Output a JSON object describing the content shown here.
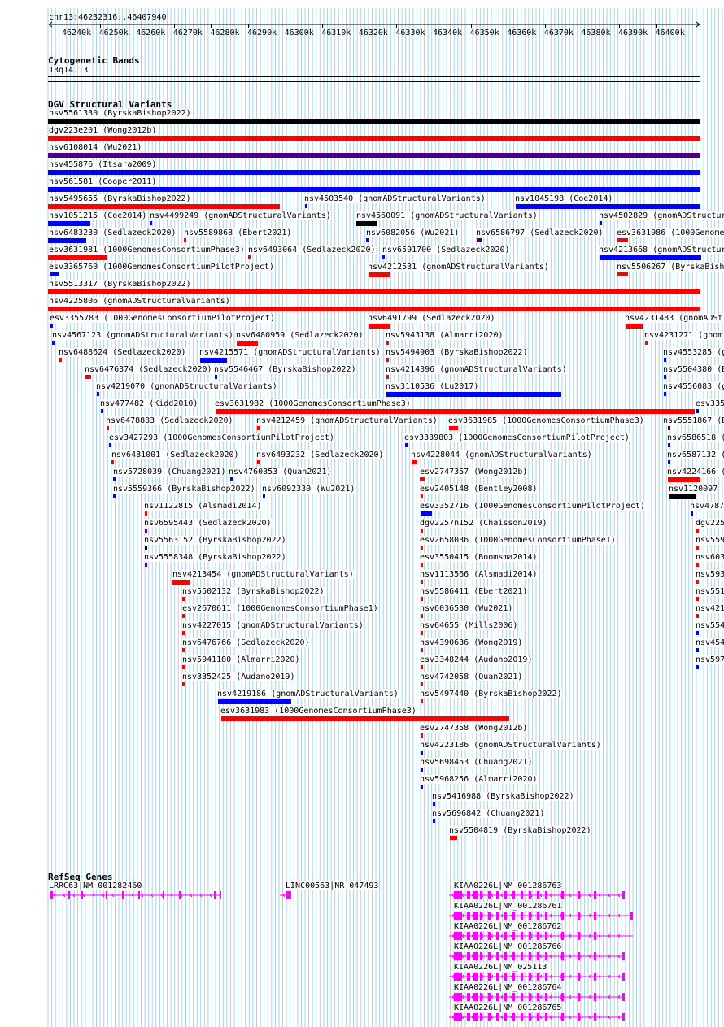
{
  "coords": "chr13:46232316..46407940",
  "ruler_ticks": [
    "46240k",
    "46250k",
    "46260k",
    "46270k",
    "46280k",
    "46290k",
    "46300k",
    "46310k",
    "46320k",
    "46330k",
    "46340k",
    "46350k",
    "46360k",
    "46370k",
    "46380k",
    "46390k",
    "46400k"
  ],
  "cyto": {
    "title": "Cytogenetic Bands",
    "band": "13q14.13"
  },
  "dgv_title": "DGV Structural Variants",
  "refseq_title": "RefSeq Genes",
  "colors": {
    "red": "#ff0000",
    "blue": "#0000ff",
    "black": "#000000",
    "purple": "#4b0082",
    "magenta": "#ff00ff",
    "grid": "#a8d4e4"
  },
  "variants": [
    {
      "label": "nsv5561330 (ByrskaBishop2022)",
      "color": "black"
    },
    {
      "label": "dgv223e201 (Wong2012b)",
      "color": "red"
    },
    {
      "label": "nsv6108014 (Wu2021)",
      "color": "purple"
    },
    {
      "label": "nsv455876 (Itsara2009)",
      "color": "blue"
    },
    {
      "label": "nsv561581 (Cooper2011)",
      "color": "blue"
    },
    {
      "label": "nsv5495655 (ByrskaBishop2022)",
      "color": "red"
    },
    {
      "label": "nsv4503540 (gnomADStructuralVariants)",
      "color": "blue"
    },
    {
      "label": "nsv1045198 (Coe2014)",
      "color": "blue"
    },
    {
      "label": "nsv1051215 (Coe2014)",
      "color": "blue"
    },
    {
      "label": "nsv4499249 (gnomADStructuralVariants)",
      "color": "blue"
    },
    {
      "label": "nsv4560091 (gnomADStructuralVariants)",
      "color": "black"
    },
    {
      "label": "nsv4502829 (gnomADStructur",
      "color": "blue"
    },
    {
      "label": "nsv6483230 (Sedlazeck2020)",
      "color": "blue"
    },
    {
      "label": "nsv5589868 (Ebert2021)",
      "color": "red"
    },
    {
      "label": "nsv6082056 (Wu2021)",
      "color": "blue"
    },
    {
      "label": "nsv6586797 (Sedlazeck2020)",
      "color": "purple"
    },
    {
      "label": "esv3631986 (1000Genome",
      "color": "red"
    },
    {
      "label": "esv3631981 (1000GenomesConsortiumPhase3)",
      "color": "red"
    },
    {
      "label": "nsv6493064 (Sedlazeck2020)",
      "color": "red"
    },
    {
      "label": "nsv6591700 (Sedlazeck2020)",
      "color": "blue"
    },
    {
      "label": "nsv4213668 (gnomADStructur",
      "color": "blue"
    },
    {
      "label": "esv3365760 (1000GenomesConsortiumPilotProject)",
      "color": "blue"
    },
    {
      "label": "nsv4212531 (gnomADStructuralVariants)",
      "color": "red"
    },
    {
      "label": "nsv5506267 (ByrskaBish",
      "color": "red"
    },
    {
      "label": "nsv5513317 (ByrskaBishop2022)",
      "color": "red"
    },
    {
      "label": "nsv4225806 (gnomADStructuralVariants)",
      "color": "red"
    },
    {
      "label": "esv3355783 (1000GenomesConsortiumPilotProject)",
      "color": "blue"
    },
    {
      "label": "nsv6491799 (Sedlazeck2020)",
      "color": "red"
    },
    {
      "label": "nsv4231483 (gnomADStr",
      "color": "red"
    },
    {
      "label": "nsv4567123 (gnomADStructuralVariants)",
      "color": "blue"
    },
    {
      "label": "nsv6480959 (Sedlazeck2020)",
      "color": "red"
    },
    {
      "label": "nsv5943138 (Almarri2020)",
      "color": "red"
    },
    {
      "label": "nsv4231271 (gnom",
      "color": "red"
    },
    {
      "label": "nsv6488624 (Sedlazeck2020)",
      "color": "red"
    },
    {
      "label": "nsv4215571 (gnomADStructuralVariants)",
      "color": "blue"
    },
    {
      "label": "nsv5494903 (ByrskaBishop2022)",
      "color": "red"
    },
    {
      "label": "nsv4553285 (g",
      "color": "blue"
    },
    {
      "label": "nsv6476374 (Sedlazeck2020)",
      "color": "red"
    },
    {
      "label": "nsv5546467 (ByrskaBishop2022)",
      "color": "blue"
    },
    {
      "label": "nsv4214396 (gnomADStructuralVariants)",
      "color": "red"
    },
    {
      "label": "nsv5504380 (B",
      "color": "blue"
    },
    {
      "label": "nsv4219070 (gnomADStructuralVariants)",
      "color": "blue"
    },
    {
      "label": "nsv3110536 (Lu2017)",
      "color": "blue"
    },
    {
      "label": "nsv4556083 (g",
      "color": "blue"
    },
    {
      "label": "nsv477482 (Kidd2010)",
      "color": "blue"
    },
    {
      "label": "esv3631982 (1000GenomesConsortiumPhase3)",
      "color": "red"
    },
    {
      "label": "esv335",
      "color": "blue"
    },
    {
      "label": "nsv6478883 (Sedlazeck2020)",
      "color": "red"
    },
    {
      "label": "nsv4212459 (gnomADStructuralVariants)",
      "color": "red"
    },
    {
      "label": "esv3631985 (1000GenomesConsortiumPhase3)",
      "color": "red"
    },
    {
      "label": "nsv5551867 (B",
      "color": "purple"
    },
    {
      "label": "esv3427293 (1000GenomesConsortiumPilotProject)",
      "color": "blue"
    },
    {
      "label": "esv3339803 (1000GenomesConsortiumPilotProject)",
      "color": "blue"
    },
    {
      "label": "nsv6586518 (",
      "color": "blue"
    },
    {
      "label": "nsv6481001 (Sedlazeck2020)",
      "color": "red"
    },
    {
      "label": "nsv6493232 (Sedlazeck2020)",
      "color": "red"
    },
    {
      "label": "nsv4228044 (gnomADStructuralVariants)",
      "color": "red"
    },
    {
      "label": "nsv6587132 (",
      "color": "blue"
    },
    {
      "label": "nsv5728039 (Chuang2021)",
      "color": "blue"
    },
    {
      "label": "nsv4760353 (Quan2021)",
      "color": "blue"
    },
    {
      "label": "esv2747357 (Wong2012b)",
      "color": "red"
    },
    {
      "label": "nsv4224166 (",
      "color": "red"
    },
    {
      "label": "nsv5559366 (ByrskaBishop2022)",
      "color": "blue"
    },
    {
      "label": "nsv6092330 (Wu2021)",
      "color": "blue"
    },
    {
      "label": "esv2405148 (Bentley2008)",
      "color": "red"
    },
    {
      "label": "nsv1120097",
      "color": "black"
    },
    {
      "label": "nsv1122815 (Alsmadi2014)",
      "color": "red"
    },
    {
      "label": "esv3352716 (1000GenomesConsortiumPilotProject)",
      "color": "blue"
    },
    {
      "label": "nsv4787",
      "color": "blue"
    },
    {
      "label": "nsv6595443 (Sedlazeck2020)",
      "color": "purple"
    },
    {
      "label": "dgv2257n152 (Chaisson2019)",
      "color": "red"
    },
    {
      "label": "dgv225",
      "color": "red"
    },
    {
      "label": "nsv5563152 (ByrskaBishop2022)",
      "color": "black"
    },
    {
      "label": "esv2658036 (1000GenomesConsortiumPhase1)",
      "color": "red"
    },
    {
      "label": "nsv559",
      "color": "red"
    },
    {
      "label": "nsv5558348 (ByrskaBishop2022)",
      "color": "purple"
    },
    {
      "label": "esv3550415 (Boomsma2014)",
      "color": "red"
    },
    {
      "label": "nsv603",
      "color": "red"
    },
    {
      "label": "nsv4213454 (gnomADStructuralVariants)",
      "color": "red"
    },
    {
      "label": "nsv1113566 (Alsmadi2014)",
      "color": "red"
    },
    {
      "label": "nsv593",
      "color": "red"
    },
    {
      "label": "nsv5502132 (ByrskaBishop2022)",
      "color": "red"
    },
    {
      "label": "nsv5586411 (Ebert2021)",
      "color": "red"
    },
    {
      "label": "nsv551",
      "color": "red"
    },
    {
      "label": "esv2670611 (1000GenomesConsortiumPhase1)",
      "color": "red"
    },
    {
      "label": "nsv6036530 (Wu2021)",
      "color": "red"
    },
    {
      "label": "nsv421",
      "color": "red"
    },
    {
      "label": "nsv4227015 (gnomADStructuralVariants)",
      "color": "red"
    },
    {
      "label": "nsv64655 (Mills2006)",
      "color": "red"
    },
    {
      "label": "nsv554",
      "color": "blue"
    },
    {
      "label": "nsv6476766 (Sedlazeck2020)",
      "color": "red"
    },
    {
      "label": "nsv4390636 (Wong2019)",
      "color": "red"
    },
    {
      "label": "nsv454",
      "color": "blue"
    },
    {
      "label": "nsv5941180 (Almarri2020)",
      "color": "red"
    },
    {
      "label": "esv3348244 (Audano2019)",
      "color": "red"
    },
    {
      "label": "nsv597",
      "color": "blue"
    },
    {
      "label": "nsv3352425 (Audano2019)",
      "color": "red"
    },
    {
      "label": "nsv4742058 (Quan2021)",
      "color": "red"
    },
    {
      "label": "nsv4219186 (gnomADStructuralVariants)",
      "color": "blue"
    },
    {
      "label": "nsv5497440 (ByrskaBishop2022)",
      "color": "red"
    },
    {
      "label": "esv3631983 (1000GenomesConsortiumPhase3)",
      "color": "red"
    },
    {
      "label": "esv2747358 (Wong2012b)",
      "color": "red"
    },
    {
      "label": "nsv4223186 (gnomADStructuralVariants)",
      "color": "blue"
    },
    {
      "label": "nsv5698453 (Chuang2021)",
      "color": "blue"
    },
    {
      "label": "nsv5968256 (Almarri2020)",
      "color": "blue"
    },
    {
      "label": "nsv5416988 (ByrskaBishop2022)",
      "color": "blue"
    },
    {
      "label": "nsv5696842 (Chuang2021)",
      "color": "blue"
    },
    {
      "label": "nsv5504819 (ByrskaBishop2022)",
      "color": "red"
    }
  ],
  "genes": [
    {
      "label": "LRRC63|NM_001282460"
    },
    {
      "label": "LINC00563|NR_047493"
    },
    {
      "label": "KIAA0226L|NM_001286763"
    },
    {
      "label": "KIAA0226L|NM_001286761"
    },
    {
      "label": "KIAA0226L|NM_001286762"
    },
    {
      "label": "KIAA0226L|NM_001286766"
    },
    {
      "label": "KIAA0226L|NM_025113"
    },
    {
      "label": "KIAA0226L|NM_001286764"
    },
    {
      "label": "KIAA0226L|NM_001286765"
    }
  ]
}
